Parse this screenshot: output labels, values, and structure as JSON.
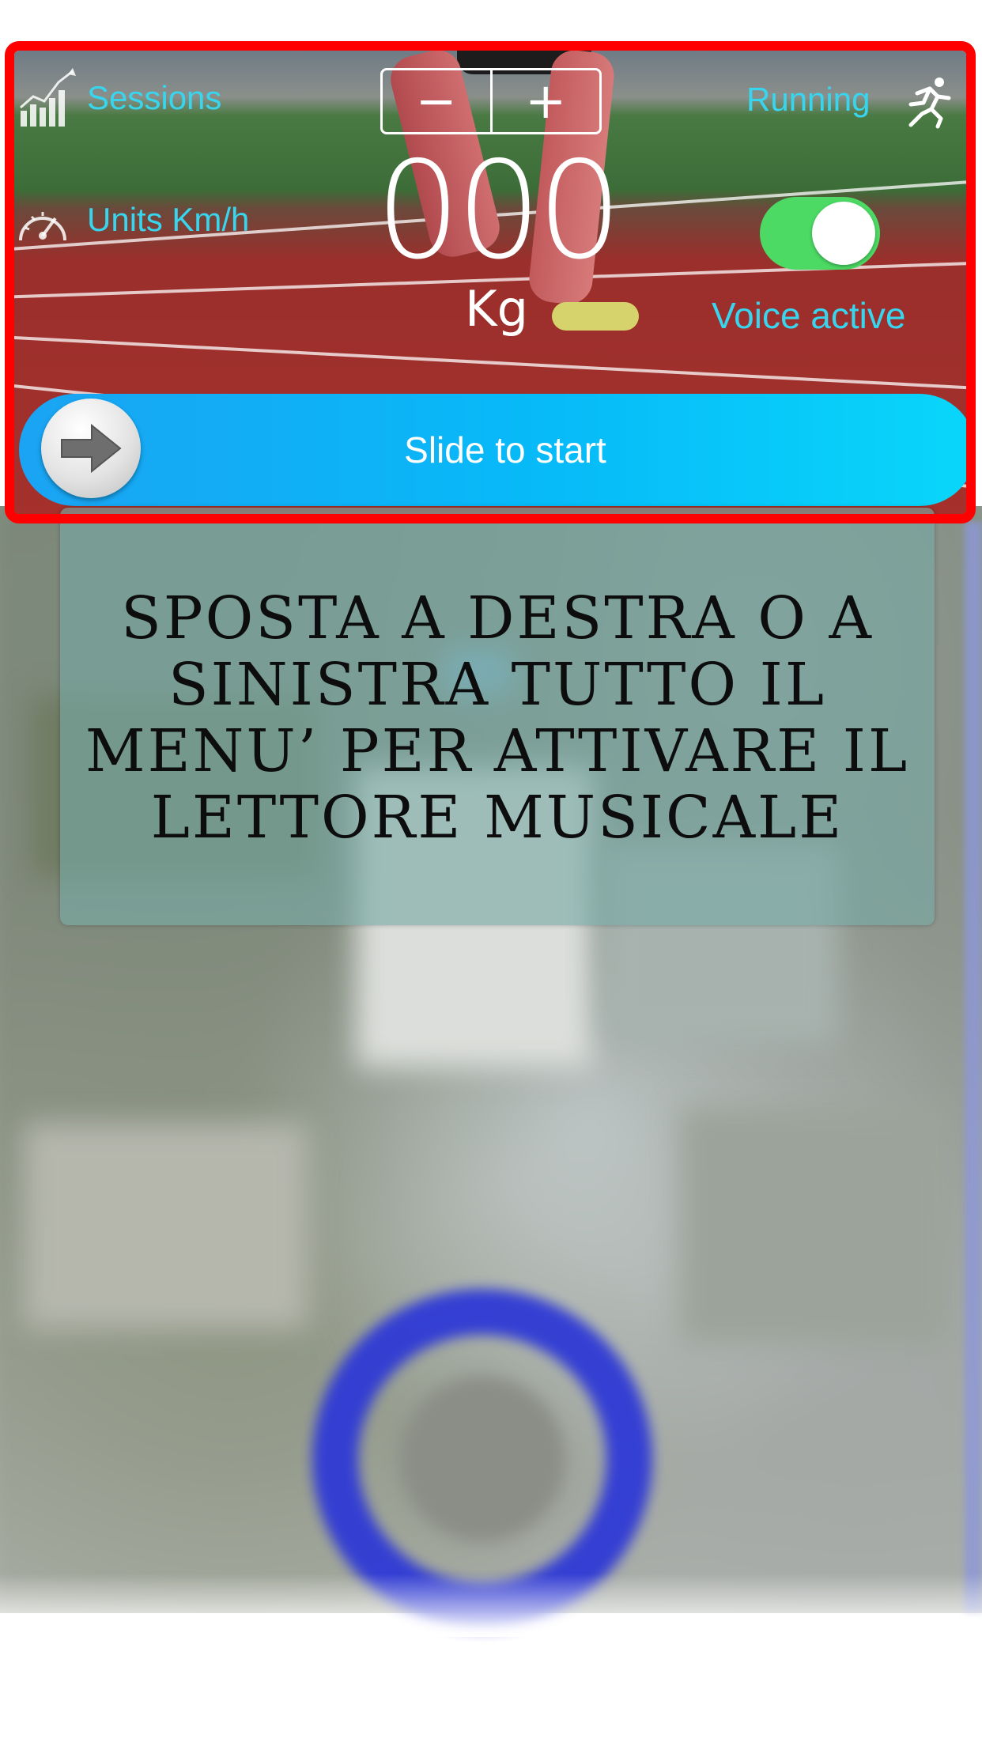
{
  "panel": {
    "sessions_label": "Sessions",
    "units_label": "Units Km/h",
    "running_label": "Running",
    "stepper": {
      "minus_label": "−",
      "plus_label": "+"
    },
    "weight": {
      "value": "000",
      "unit": "Kg"
    },
    "voice": {
      "label": "Voice active",
      "enabled": true
    },
    "slider": {
      "label": "Slide to start"
    },
    "icons": {
      "sessions": "bar-chart-icon",
      "units": "speedometer-icon",
      "running": "runner-icon",
      "slider_knob": "arrow-right-icon"
    }
  },
  "hint": {
    "text": "Sposta a destra o a sinistra tutto il menu’ per attivare il lettore musicale"
  },
  "colors": {
    "highlight_frame": "#ff0000",
    "label_cyan": "#38d5ee",
    "toggle_on": "#4cd964",
    "slider_start": "#1aa4f3",
    "slider_end": "#09d6fa",
    "map_ring": "#2f3ad6"
  }
}
